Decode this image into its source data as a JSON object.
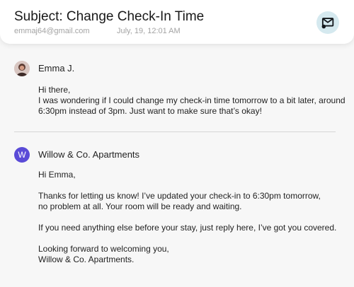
{
  "header": {
    "subject": "Subject: Change Check-In Time",
    "sender_email": "emmaj64@gmail.com",
    "sent_time": "July, 19, 12:01 AM",
    "mail_icon": "mail-icon"
  },
  "messages": [
    {
      "name": "Emma J.",
      "avatar": "profile-photo",
      "lines": [
        "Hi there,",
        "I was wondering if I could change my check-in time tomorrow to a bit later, around",
        "6:30pm instead of 3pm. Just want to make sure that’s okay!"
      ]
    },
    {
      "name": "Willow & Co. Apartments",
      "avatar_initial": "W",
      "lines": [
        "Hi Emma,",
        "Thanks for letting us know! I’ve updated your check-in to 6:30pm tomorrow,",
        "no problem at all. Your room will be ready and waiting.",
        "If you need anything else before your stay, just reply here, I’ve got you covered.",
        "Looking forward to welcoming you,",
        "Willow & Co. Apartments."
      ]
    }
  ],
  "colors": {
    "background": "#f7f7f7",
    "header_background": "#ffffff",
    "mail_button": "#d5e9ef",
    "company_avatar": "#5a4bd7",
    "divider": "#d7d7d7"
  }
}
